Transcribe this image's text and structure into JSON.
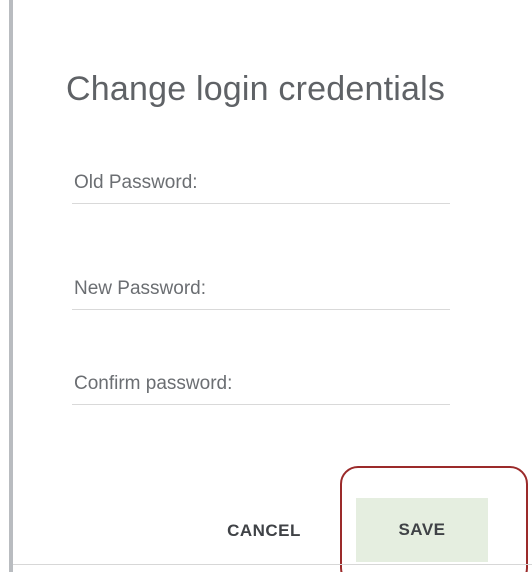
{
  "dialog": {
    "title": "Change login credentials",
    "fields": {
      "old_password": {
        "placeholder": "Old Password:",
        "value": ""
      },
      "new_password": {
        "placeholder": "New Password:",
        "value": ""
      },
      "confirm_password": {
        "placeholder": "Confirm password:",
        "value": ""
      }
    },
    "actions": {
      "cancel_label": "CANCEL",
      "save_label": "SAVE"
    }
  },
  "colors": {
    "title_text": "#5f6266",
    "button_text": "#3f4246",
    "save_background": "#e5eee0",
    "highlight_ring": "#9b2a2a",
    "field_underline": "#d9d9d9"
  }
}
